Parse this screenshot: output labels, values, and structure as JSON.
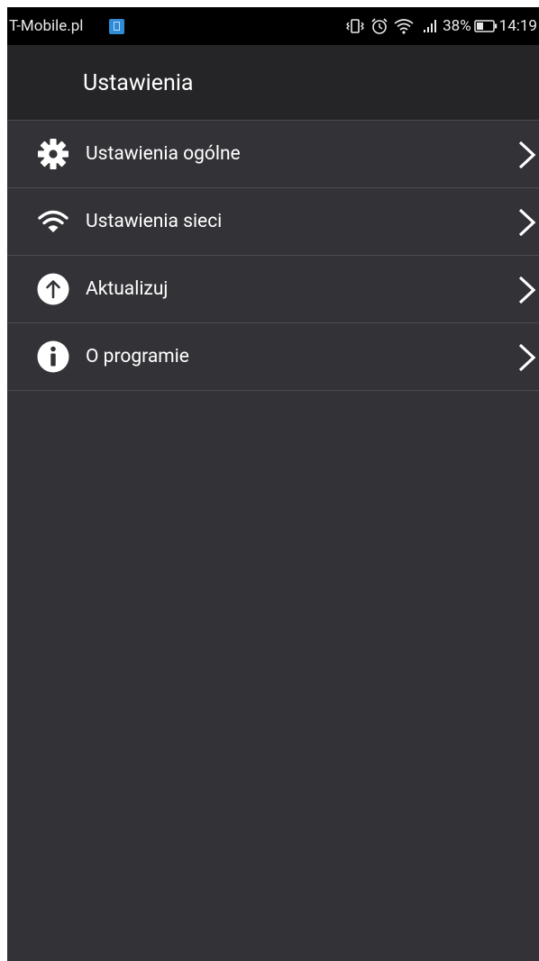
{
  "status_bar": {
    "carrier": "T-Mobile.pl",
    "battery_percent": "38%",
    "time": "14:19",
    "icons": [
      "notification-icon",
      "vibrate-icon",
      "alarm-icon",
      "wifi-icon",
      "signal-icon",
      "battery-icon"
    ]
  },
  "app_bar": {
    "title": "Ustawienia"
  },
  "settings": {
    "items": [
      {
        "label": "Ustawienia ogólne",
        "icon": "gear-icon"
      },
      {
        "label": "Ustawienia sieci",
        "icon": "wifi-icon"
      },
      {
        "label": "Aktualizuj",
        "icon": "upload-arrow-icon"
      },
      {
        "label": "O programie",
        "icon": "info-icon"
      }
    ]
  },
  "colors": {
    "background": "#333337",
    "app_bar": "#252527",
    "status_bar": "#000000",
    "divider": "#4c4c50",
    "text": "#ffffff"
  }
}
